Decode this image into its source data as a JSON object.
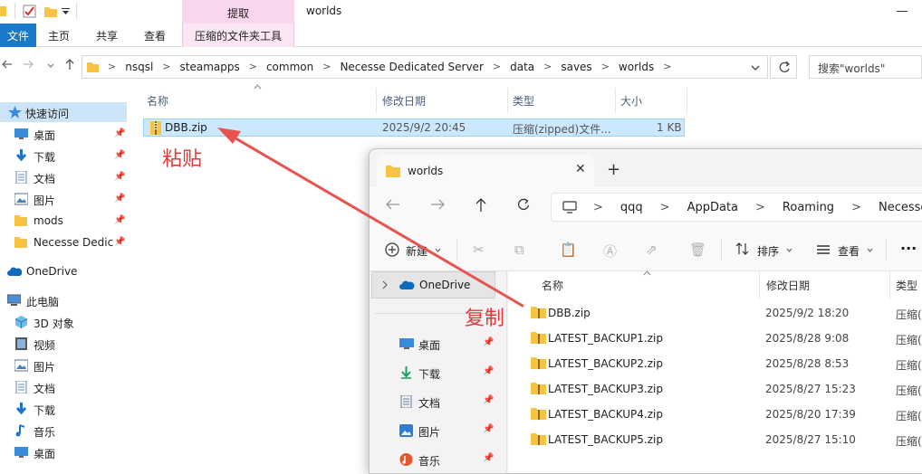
{
  "back_window": {
    "title": "worlds",
    "context_tab_label": "提取",
    "ribbon_tabs": [
      "文件",
      "主页",
      "共享",
      "查看",
      "压缩的文件夹工具"
    ],
    "breadcrumb": [
      "nsqsl",
      "steamapps",
      "common",
      "Necesse Dedicated Server",
      "data",
      "saves",
      "worlds"
    ],
    "search_placeholder": "搜索\"worlds\"",
    "columns": {
      "name": "名称",
      "date": "修改日期",
      "type": "类型",
      "size": "大小"
    },
    "files": [
      {
        "name": "DBB.zip",
        "date": "2025/9/2 20:45",
        "type": "压缩(zipped)文件...",
        "size": "1 KB"
      }
    ],
    "nav": [
      {
        "label": "快速访问",
        "icon": "star-icon",
        "selected": true
      },
      {
        "label": "桌面",
        "icon": "desktop-icon",
        "pinned": true
      },
      {
        "label": "下载",
        "icon": "download-icon",
        "pinned": true
      },
      {
        "label": "文档",
        "icon": "document-icon",
        "pinned": true
      },
      {
        "label": "图片",
        "icon": "picture-icon",
        "pinned": true
      },
      {
        "label": "mods",
        "icon": "folder-icon",
        "pinned": true
      },
      {
        "label": "Necesse Dedic",
        "icon": "folder-icon",
        "pinned": true
      },
      {
        "label": "OneDrive",
        "icon": "cloud-icon"
      },
      {
        "label": "此电脑",
        "icon": "computer-icon"
      },
      {
        "label": "3D 对象",
        "icon": "cube-icon"
      },
      {
        "label": "视频",
        "icon": "video-icon"
      },
      {
        "label": "图片",
        "icon": "picture-icon"
      },
      {
        "label": "文档",
        "icon": "document-icon"
      },
      {
        "label": "下载",
        "icon": "download-icon"
      },
      {
        "label": "音乐",
        "icon": "music-icon"
      },
      {
        "label": "桌面",
        "icon": "desktop-icon"
      }
    ]
  },
  "front_window": {
    "tab_title": "worlds",
    "breadcrumb": [
      "qqq",
      "AppData",
      "Roaming",
      "Necesse"
    ],
    "commands": {
      "new": "新建",
      "sort": "排序",
      "view": "查看"
    },
    "nav": [
      {
        "label": "OneDrive",
        "icon": "cloud-icon"
      },
      {
        "label": "桌面",
        "icon": "desktop-icon"
      },
      {
        "label": "下载",
        "icon": "download-icon"
      },
      {
        "label": "文档",
        "icon": "document-icon"
      },
      {
        "label": "图片",
        "icon": "picture-icon"
      },
      {
        "label": "音乐",
        "icon": "music-icon"
      }
    ],
    "columns": {
      "name": "名称",
      "date": "修改日期",
      "type": "类型"
    },
    "files": [
      {
        "name": "DBB.zip",
        "date": "2025/9/2 18:20",
        "type": "压缩("
      },
      {
        "name": "LATEST_BACKUP1.zip",
        "date": "2025/8/28 9:08",
        "type": "压缩("
      },
      {
        "name": "LATEST_BACKUP2.zip",
        "date": "2025/8/28 8:53",
        "type": "压缩("
      },
      {
        "name": "LATEST_BACKUP3.zip",
        "date": "2025/8/27 15:23",
        "type": "压缩("
      },
      {
        "name": "LATEST_BACKUP4.zip",
        "date": "2025/8/20 17:39",
        "type": "压缩("
      },
      {
        "name": "LATEST_BACKUP5.zip",
        "date": "2025/8/27 15:10",
        "type": "压缩("
      }
    ]
  },
  "annotations": {
    "paste": "粘贴",
    "copy": "复制"
  },
  "colors": {
    "annotation": "#e23a3a",
    "selection": "#cce8ff",
    "file_tab": "#1979ca",
    "context_tab": "#f8d6ee",
    "folder": "#f6c343"
  }
}
